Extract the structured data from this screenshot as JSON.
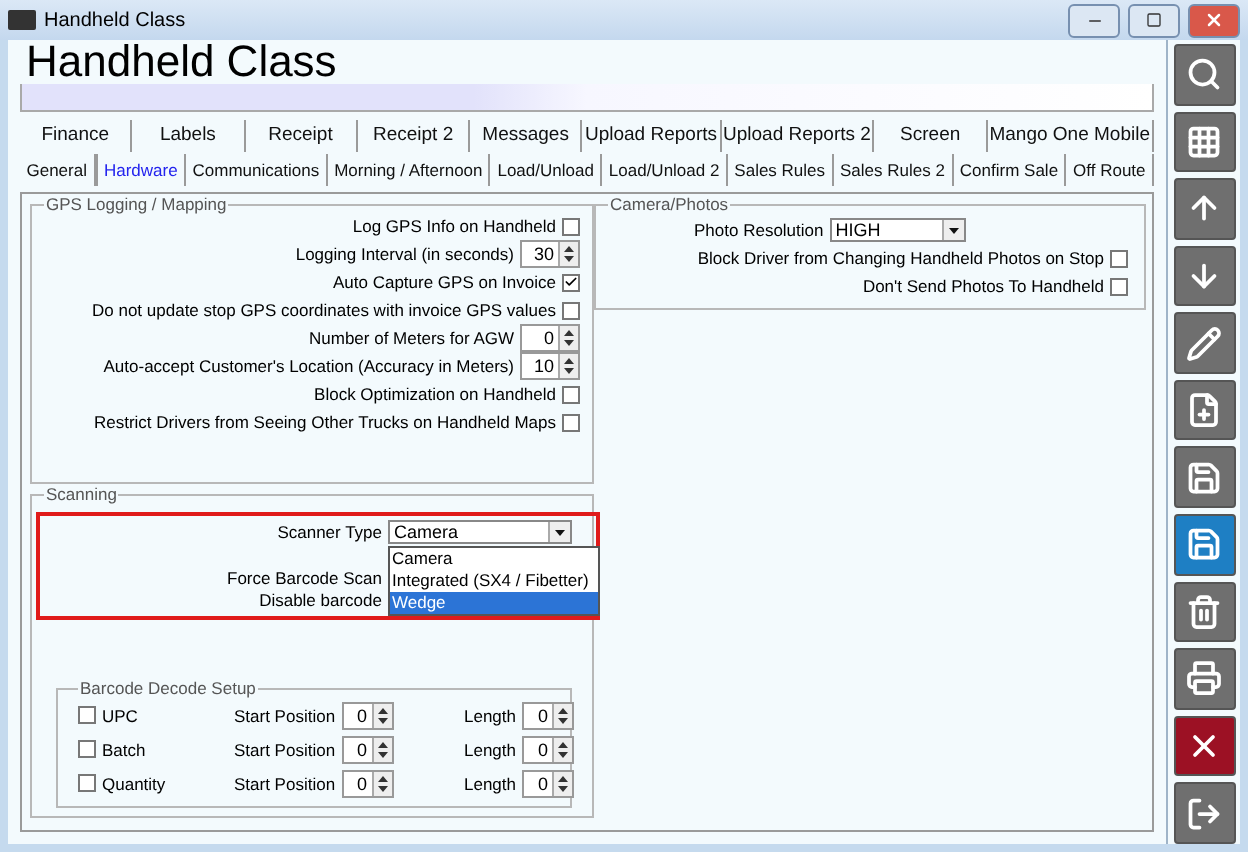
{
  "window": {
    "title": "Handheld Class"
  },
  "heading": "Handheld Class",
  "tabs_row_1": [
    {
      "label": "Finance",
      "selected": false
    },
    {
      "label": "Labels",
      "selected": false
    },
    {
      "label": "Receipt",
      "selected": false
    },
    {
      "label": "Receipt 2",
      "selected": false
    },
    {
      "label": "Messages",
      "selected": false
    },
    {
      "label": "Upload Reports",
      "selected": false
    },
    {
      "label": "Upload Reports 2",
      "selected": false
    },
    {
      "label": "Screen",
      "selected": false
    },
    {
      "label": "Mango One Mobile",
      "selected": false
    }
  ],
  "tabs_row_2": [
    {
      "label": "General",
      "selected": false
    },
    {
      "label": "Hardware",
      "selected": true
    },
    {
      "label": "Communications",
      "selected": false
    },
    {
      "label": "Morning / Afternoon",
      "selected": false
    },
    {
      "label": "Load/Unload",
      "selected": false
    },
    {
      "label": "Load/Unload 2",
      "selected": false
    },
    {
      "label": "Sales Rules",
      "selected": false
    },
    {
      "label": "Sales Rules 2",
      "selected": false
    },
    {
      "label": "Confirm Sale",
      "selected": false
    },
    {
      "label": "Off Route",
      "selected": false
    }
  ],
  "gps_group": {
    "title": "GPS Logging / Mapping",
    "rows": [
      {
        "kind": "checkbox",
        "label": "Log GPS Info on Handheld",
        "checked": false
      },
      {
        "kind": "spinner",
        "label": "Logging Interval (in seconds)",
        "value": "30"
      },
      {
        "kind": "checkbox",
        "label": "Auto Capture GPS on Invoice",
        "checked": true
      },
      {
        "kind": "checkbox",
        "label": "Do not update stop GPS coordinates with invoice GPS values",
        "checked": false
      },
      {
        "kind": "spinner",
        "label": "Number of Meters for AGW",
        "value": "0"
      },
      {
        "kind": "spinner",
        "label": "Auto-accept Customer's Location (Accuracy in Meters)",
        "value": "10"
      },
      {
        "kind": "checkbox",
        "label": "Block Optimization on Handheld",
        "checked": false
      },
      {
        "kind": "checkbox",
        "label": "Restrict Drivers from Seeing Other Trucks on Handheld Maps",
        "checked": false
      }
    ]
  },
  "camera_group": {
    "title": "Camera/Photos",
    "rows": [
      {
        "kind": "select",
        "label": "Photo Resolution",
        "value": "HIGH"
      },
      {
        "kind": "checkbox",
        "label": "Block Driver from Changing Handheld Photos on Stop",
        "checked": false
      },
      {
        "kind": "checkbox",
        "label": "Don't Send Photos To Handheld",
        "checked": false
      }
    ]
  },
  "scanning_group": {
    "title": "Scanning",
    "scanner_type": {
      "label": "Scanner Type",
      "value": "Camera",
      "options": [
        {
          "label": "Camera",
          "highlighted": false
        },
        {
          "label": "Integrated (SX4 / Fibetter)",
          "highlighted": false
        },
        {
          "label": "Wedge",
          "highlighted": true
        }
      ]
    },
    "hidden_labels": [
      "Force Barcode Scan",
      "Disable barcode"
    ]
  },
  "barcode_group": {
    "title": "Barcode Decode Setup",
    "rows": [
      {
        "label": "UPC",
        "checked": false,
        "start_label": "Start Position",
        "start": "0",
        "length_label": "Length",
        "length": "0"
      },
      {
        "label": "Batch",
        "checked": false,
        "start_label": "Start Position",
        "start": "0",
        "length_label": "Length",
        "length": "0"
      },
      {
        "label": "Quantity",
        "checked": false,
        "start_label": "Start Position",
        "start": "0",
        "length_label": "Length",
        "length": "0"
      }
    ]
  },
  "toolbar": [
    {
      "kind": "search"
    },
    {
      "kind": "grid"
    },
    {
      "kind": "up"
    },
    {
      "kind": "down"
    },
    {
      "kind": "edit"
    },
    {
      "kind": "new"
    },
    {
      "kind": "save-new"
    },
    {
      "kind": "save"
    },
    {
      "kind": "delete"
    },
    {
      "kind": "print"
    },
    {
      "kind": "close"
    },
    {
      "kind": "exit"
    }
  ]
}
